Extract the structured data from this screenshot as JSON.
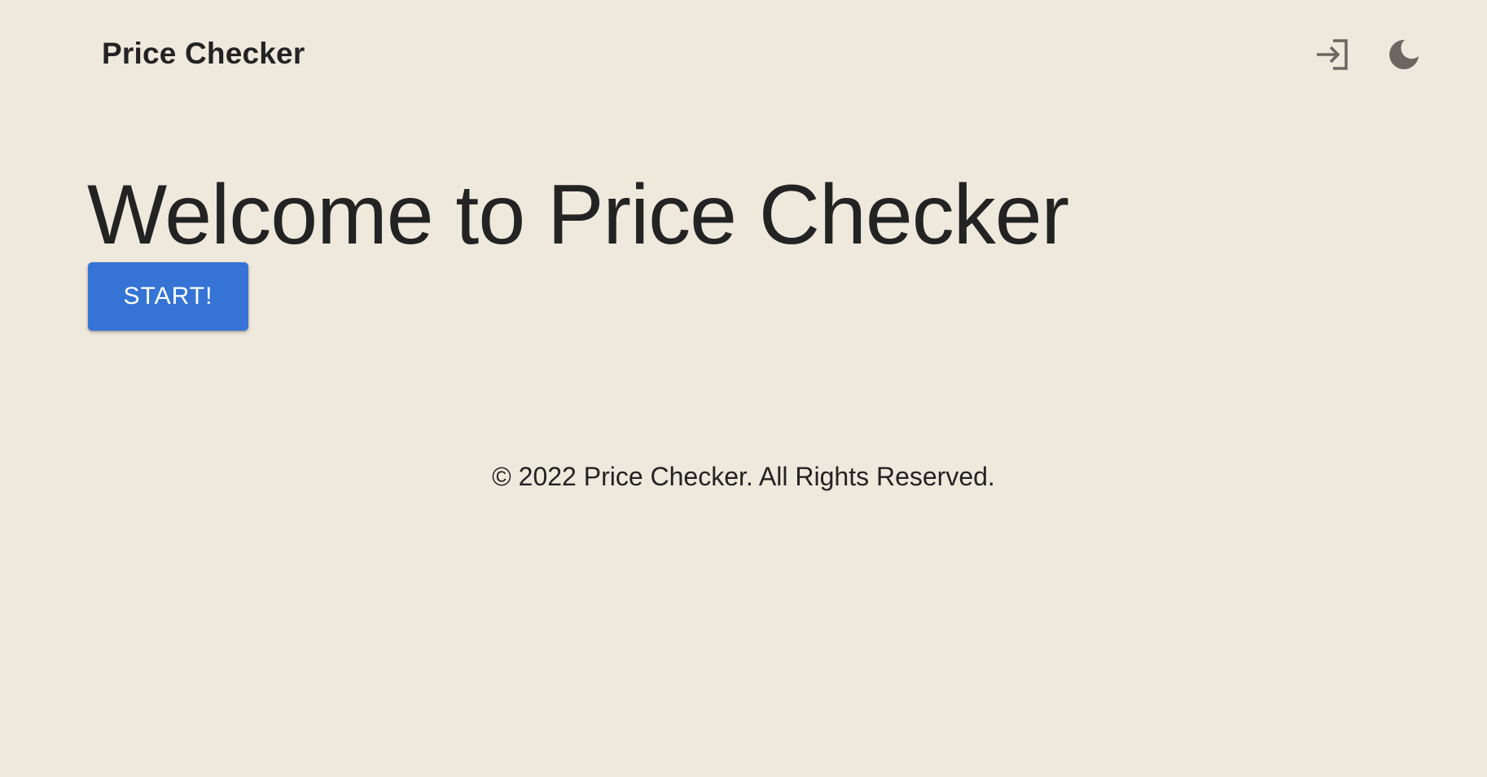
{
  "header": {
    "brand": "Price Checker",
    "login_icon": "login-icon",
    "theme_icon": "moon-icon"
  },
  "hero": {
    "title": "Welcome to Price Checker",
    "start_label": "START!"
  },
  "footer": {
    "copyright": "© 2022 Price Checker. All Rights Reserved."
  },
  "colors": {
    "background": "#efe8dd",
    "text": "#232323",
    "primary_button": "#3574d4",
    "icon": "#6b6660"
  }
}
